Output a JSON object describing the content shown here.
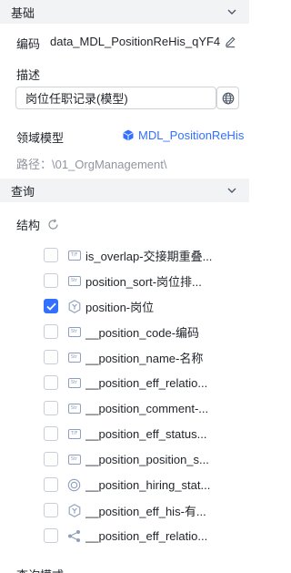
{
  "basics": {
    "section_title": "基础",
    "code_label": "编码",
    "code_value": "data_MDL_PositionReHis_qYF4",
    "desc_label": "描述",
    "desc_value": "岗位任职记录(模型)",
    "domain_label": "领域模型",
    "domain_value": "MDL_PositionReHis",
    "path_text": "路径：\\01_OrgManagement\\"
  },
  "query": {
    "section_title": "查询",
    "structure_label": "结构",
    "fields": [
      {
        "name": "is_overlap-交接期重叠...",
        "icon": "tf-type-icon",
        "type_text": "T/F",
        "checked": false
      },
      {
        "name": "position_sort-岗位排...",
        "icon": "string-type-icon",
        "type_text": "Str",
        "checked": false
      },
      {
        "name": "position-岗位",
        "icon": "entity-hexagon-icon",
        "checked": true
      },
      {
        "name": "__position_code-编码",
        "icon": "string-type-icon",
        "type_text": "Str",
        "checked": false
      },
      {
        "name": "__position_name-名称",
        "icon": "string-type-icon",
        "type_text": "Str",
        "checked": false
      },
      {
        "name": "__position_eff_relatio...",
        "icon": "string-type-icon",
        "type_text": "Str",
        "checked": false
      },
      {
        "name": "__position_comment-...",
        "icon": "string-type-icon",
        "type_text": "Str",
        "checked": false
      },
      {
        "name": "__position_eff_status...",
        "icon": "tf-type-icon",
        "type_text": "T/F",
        "checked": false
      },
      {
        "name": "__position_position_s...",
        "icon": "string-type-icon",
        "type_text": "Str",
        "checked": false
      },
      {
        "name": "__position_hiring_stat...",
        "icon": "enum-circle-icon",
        "checked": false
      },
      {
        "name": "__position_eff_his-有...",
        "icon": "entity-hexagon-icon",
        "checked": false
      },
      {
        "name": "__position_eff_relatio...",
        "icon": "relation-share-icon",
        "checked": false
      }
    ],
    "next_section_partial": "查询模式"
  },
  "colors": {
    "accent": "#3370ff",
    "header_bg": "#f2f3f5",
    "muted_text": "#8f959e"
  }
}
